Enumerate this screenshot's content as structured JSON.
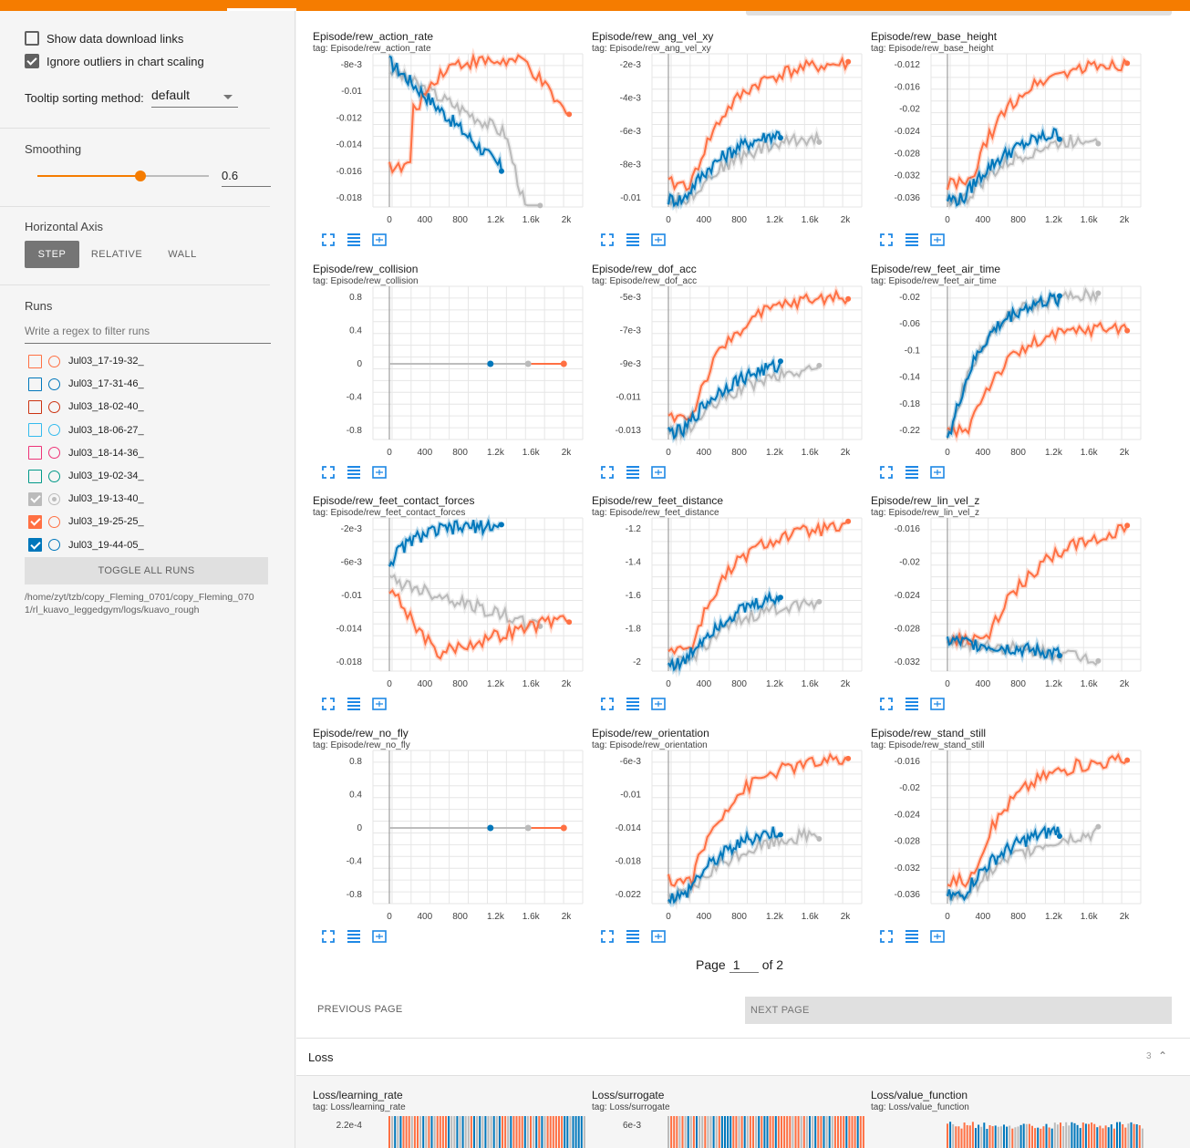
{
  "sidebar": {
    "show_download_links": "Show data download links",
    "show_download_links_checked": false,
    "ignore_outliers": "Ignore outliers in chart scaling",
    "ignore_outliers_checked": true,
    "tooltip_sorting_label": "Tooltip sorting method:",
    "tooltip_sorting_value": "default",
    "smoothing_label": "Smoothing",
    "smoothing_value": "0.6",
    "smoothing_fraction": 0.6,
    "horizontal_axis_label": "Horizontal Axis",
    "axis_options": [
      "STEP",
      "RELATIVE",
      "WALL"
    ],
    "axis_selected": "STEP",
    "runs_label": "Runs",
    "regex_placeholder": "Write a regex to filter runs",
    "runs": [
      {
        "name": "Jul03_17-19-32_",
        "color": "#ff7043",
        "checked": false
      },
      {
        "name": "Jul03_17-31-46_",
        "color": "#0077bb",
        "checked": false
      },
      {
        "name": "Jul03_18-02-40_",
        "color": "#cc3311",
        "checked": false
      },
      {
        "name": "Jul03_18-06-27_",
        "color": "#33bbee",
        "checked": false
      },
      {
        "name": "Jul03_18-14-36_",
        "color": "#ee3377",
        "checked": false
      },
      {
        "name": "Jul03_19-02-34_",
        "color": "#009988",
        "checked": false
      },
      {
        "name": "Jul03_19-13-40_",
        "color": "#bbbbbb",
        "checked": true
      },
      {
        "name": "Jul03_19-25-25_",
        "color": "#ff7043",
        "checked": true
      },
      {
        "name": "Jul03_19-44-05_",
        "color": "#0077bb",
        "checked": true
      }
    ],
    "toggle_all": "TOGGLE ALL RUNS",
    "logdir": "/home/zyt/tzb/copy_Fleming_0701/copy_Fleming_0701/rl_kuavo_leggedgym/logs/kuavo_rough"
  },
  "colors": {
    "accent": "#f57c00",
    "orange_run": "#ff7043",
    "blue_run": "#0077bb",
    "gray_run": "#bbbbbb",
    "tool_icon": "#1e88e5"
  },
  "charts": [
    {
      "title": "Episode/rew_action_rate",
      "tag": "tag: Episode/rew_action_rate",
      "yticks": [
        "-8e-3",
        "-0.01",
        "-0.012",
        "-0.014",
        "-0.016",
        "-0.018"
      ],
      "xticks": [
        "0",
        "400",
        "800",
        "1.2k",
        "1.6k",
        "2k"
      ],
      "shape": "action_rate"
    },
    {
      "title": "Episode/rew_ang_vel_xy",
      "tag": "tag: Episode/rew_ang_vel_xy",
      "yticks": [
        "-2e-3",
        "-4e-3",
        "-6e-3",
        "-8e-3",
        "-0.01"
      ],
      "xticks": [
        "0",
        "400",
        "800",
        "1.2k",
        "1.6k",
        "2k"
      ],
      "shape": "rise"
    },
    {
      "title": "Episode/rew_base_height",
      "tag": "tag: Episode/rew_base_height",
      "yticks": [
        "-0.012",
        "-0.016",
        "-0.02",
        "-0.024",
        "-0.028",
        "-0.032",
        "-0.036"
      ],
      "xticks": [
        "0",
        "400",
        "800",
        "1.2k",
        "1.6k",
        "2k"
      ],
      "shape": "rise"
    },
    {
      "title": "Episode/rew_collision",
      "tag": "tag: Episode/rew_collision",
      "yticks": [
        "0.8",
        "0.4",
        "0",
        "-0.4",
        "-0.8"
      ],
      "xticks": [
        "0",
        "400",
        "800",
        "1.2k",
        "1.6k",
        "2k"
      ],
      "shape": "flat"
    },
    {
      "title": "Episode/rew_dof_acc",
      "tag": "tag: Episode/rew_dof_acc",
      "yticks": [
        "-5e-3",
        "-7e-3",
        "-9e-3",
        "-0.011",
        "-0.013"
      ],
      "xticks": [
        "0",
        "400",
        "800",
        "1.2k",
        "1.6k",
        "2k"
      ],
      "shape": "rise_fast"
    },
    {
      "title": "Episode/rew_feet_air_time",
      "tag": "tag: Episode/rew_feet_air_time",
      "yticks": [
        "-0.02",
        "-0.06",
        "-0.1",
        "-0.14",
        "-0.18",
        "-0.22"
      ],
      "xticks": [
        "0",
        "400",
        "800",
        "1.2k",
        "1.6k",
        "2k"
      ],
      "shape": "air_time"
    },
    {
      "title": "Episode/rew_feet_contact_forces",
      "tag": "tag: Episode/rew_feet_contact_forces",
      "yticks": [
        "-2e-3",
        "-6e-3",
        "-0.01",
        "-0.014",
        "-0.018"
      ],
      "xticks": [
        "0",
        "400",
        "800",
        "1.2k",
        "1.6k",
        "2k"
      ],
      "shape": "contact"
    },
    {
      "title": "Episode/rew_feet_distance",
      "tag": "tag: Episode/rew_feet_distance",
      "yticks": [
        "-1.2",
        "-1.4",
        "-1.6",
        "-1.8",
        "-2"
      ],
      "xticks": [
        "0",
        "400",
        "800",
        "1.2k",
        "1.6k",
        "2k"
      ],
      "shape": "rise"
    },
    {
      "title": "Episode/rew_lin_vel_z",
      "tag": "tag: Episode/rew_lin_vel_z",
      "yticks": [
        "-0.016",
        "-0.02",
        "-0.024",
        "-0.028",
        "-0.032"
      ],
      "xticks": [
        "0",
        "400",
        "800",
        "1.2k",
        "1.6k",
        "2k"
      ],
      "shape": "lin_vel"
    },
    {
      "title": "Episode/rew_no_fly",
      "tag": "tag: Episode/rew_no_fly",
      "yticks": [
        "0.8",
        "0.4",
        "0",
        "-0.4",
        "-0.8"
      ],
      "xticks": [
        "0",
        "400",
        "800",
        "1.2k",
        "1.6k",
        "2k"
      ],
      "shape": "flat"
    },
    {
      "title": "Episode/rew_orientation",
      "tag": "tag: Episode/rew_orientation",
      "yticks": [
        "-6e-3",
        "-0.01",
        "-0.014",
        "-0.018",
        "-0.022"
      ],
      "xticks": [
        "0",
        "400",
        "800",
        "1.2k",
        "1.6k",
        "2k"
      ],
      "shape": "rise"
    },
    {
      "title": "Episode/rew_stand_still",
      "tag": "tag: Episode/rew_stand_still",
      "yticks": [
        "-0.016",
        "-0.02",
        "-0.024",
        "-0.028",
        "-0.032",
        "-0.036"
      ],
      "xticks": [
        "0",
        "400",
        "800",
        "1.2k",
        "1.6k",
        "2k"
      ],
      "shape": "rise"
    }
  ],
  "pagination": {
    "page_label": "Page",
    "page_value": "1",
    "of_label": "of 2",
    "prev": "PREVIOUS PAGE",
    "next": "NEXT PAGE"
  },
  "loss_section": {
    "title": "Loss",
    "count": "3"
  },
  "loss_charts": [
    {
      "title": "Loss/learning_rate",
      "tag": "tag: Loss/learning_rate",
      "ytick": "2.2e-4"
    },
    {
      "title": "Loss/surrogate",
      "tag": "tag: Loss/surrogate",
      "ytick": "6e-3"
    },
    {
      "title": "Loss/value_function",
      "tag": "tag: Loss/value_function",
      "ytick": ""
    }
  ]
}
